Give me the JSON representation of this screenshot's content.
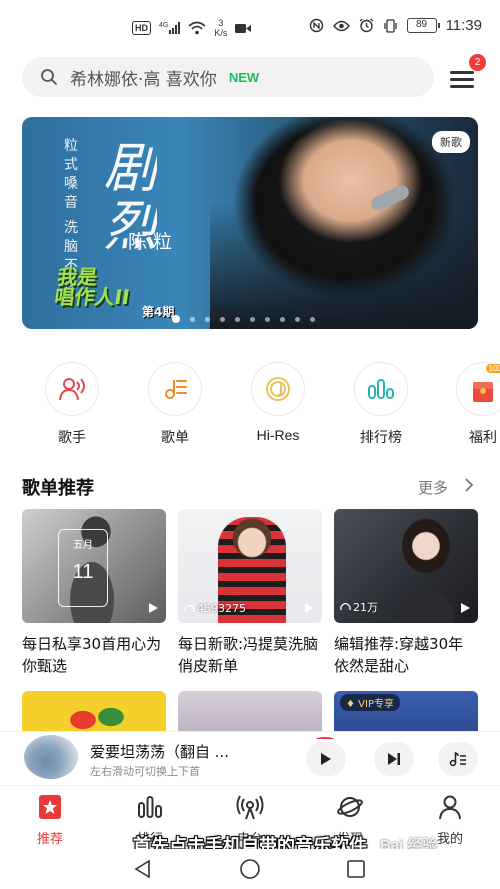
{
  "status_bar": {
    "hd": "HD",
    "network": "4G",
    "speed_value": "3",
    "speed_unit": "K/s",
    "battery": "89",
    "time": "11:39"
  },
  "search": {
    "placeholder": "希林娜依·高 喜欢你",
    "new_tag": "NEW",
    "menu_badge": "2"
  },
  "banner": {
    "tag": "新歌",
    "side_text_1": "粒式嗓音",
    "side_text_2": "洗脑不停",
    "title": "剧烈",
    "artist": "陈粒",
    "show_line_1": "我是",
    "show_line_2": "唱作人II",
    "episode": "第4期",
    "dot_count": 10,
    "active_dot": 0
  },
  "categories": [
    {
      "label": "歌手",
      "icon": "singer-icon"
    },
    {
      "label": "歌单",
      "icon": "playlist-icon"
    },
    {
      "label": "Hi-Res",
      "icon": "hires-icon"
    },
    {
      "label": "排行榜",
      "icon": "chart-icon"
    },
    {
      "label": "福利",
      "icon": "gift-icon"
    }
  ],
  "welfare_badge": "100",
  "section": {
    "title": "歌单推荐",
    "more": "更多"
  },
  "cards": [
    {
      "title": "每日私享30首用心为你甄选",
      "count": "",
      "overlay_month": "五月",
      "overlay_day": "11"
    },
    {
      "title": "每日新歌:冯提莫洗脑俏皮新单",
      "count": "4593275"
    },
    {
      "title": "编辑推荐:穿越30年依然是甜心",
      "count": "21万"
    }
  ],
  "row2_badge": "VIP专享",
  "player": {
    "title": "爱要坦荡荡（翻自 ...",
    "subtitle": "左右滑动可切换上下首"
  },
  "bottom_nav": [
    {
      "label": "推荐",
      "icon": "star-icon",
      "active": true
    },
    {
      "label": "排行",
      "icon": "rank-icon",
      "active": false
    },
    {
      "label": "电台",
      "icon": "radio-icon",
      "active": false
    },
    {
      "label": "发现",
      "icon": "discover-icon",
      "active": false
    },
    {
      "label": "我的",
      "icon": "profile-icon",
      "active": false
    }
  ],
  "caption": "首先点击手机自带的音乐软件",
  "watermark": "Bai 经验",
  "colors": {
    "accent_red": "#e93a3a",
    "new_green": "#1dbd5b"
  }
}
